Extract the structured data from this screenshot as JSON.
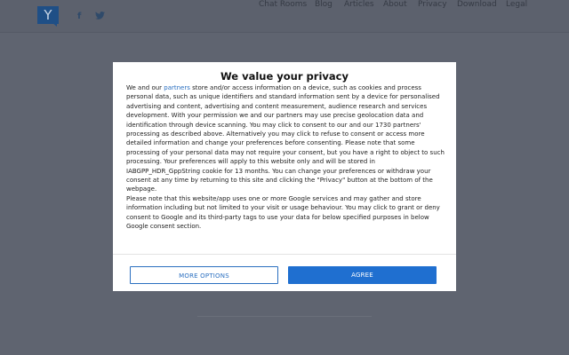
{
  "header": {
    "logo_letter": "Y",
    "social": {
      "facebook_glyph": "f",
      "twitter_glyph": "🐦"
    },
    "nav": [
      "Chat Rooms",
      "Blog",
      "Articles",
      "About",
      "Privacy",
      "Download",
      "Legal"
    ]
  },
  "consent": {
    "title": "We value your privacy",
    "intro_before_link": "We and our ",
    "link_text": "partners",
    "intro_after_link": " store and/or access information on a device, such as cookies and process personal data, such as unique identifiers and standard information sent by a device for personalised advertising and content, advertising and content measurement, audience research and services development. With your permission we and our partners may use precise geolocation data and identification through device scanning. You may click to consent to our and our 1730 partners' processing as described above. Alternatively you may click to refuse to consent or access more detailed information and change your preferences before consenting. Please note that some processing of your personal data may not require your consent, but you have a right to object to such processing. Your preferences will apply to this website only and will be stored in IABGPP_HDR_GppString cookie for 13 months. You can change your preferences or withdraw your consent at any time by returning to this site and clicking the \"Privacy\" button at the bottom of the webpage.",
    "google_notice": "Please note that this website/app uses one or more Google services and may gather and store information including but not limited to your visit or usage behaviour. You may click to grant or deny consent to Google and its third-party tags to use your data for below specified purposes in below Google consent section.",
    "more_options_label": "MORE OPTIONS",
    "agree_label": "AGREE"
  }
}
